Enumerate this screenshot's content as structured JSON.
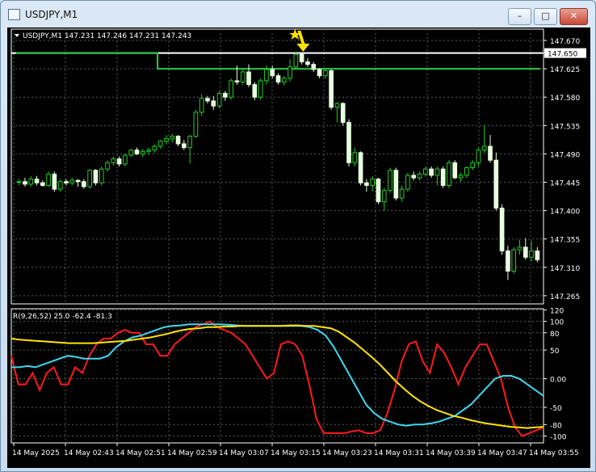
{
  "window": {
    "title": "USDJPY,M1",
    "buttons": {
      "minimize": "–",
      "maximize": "□",
      "close": "✕"
    }
  },
  "chart_data": [
    {
      "type": "candlestick",
      "info": "USDJPY,M1  147.231 147.246 147.231 147.243",
      "price_ticks": [
        "147.670",
        "147.625",
        "147.580",
        "147.535",
        "147.490",
        "147.445",
        "147.400",
        "147.355",
        "147.310",
        "147.265"
      ],
      "ylim": [
        147.252,
        147.688
      ],
      "current_price_label": "147.650",
      "candles": [
        [
          147.445,
          147.45,
          147.44,
          147.446
        ],
        [
          147.446,
          147.452,
          147.438,
          147.442
        ],
        [
          147.442,
          147.455,
          147.438,
          147.45
        ],
        [
          147.45,
          147.455,
          147.44,
          147.444
        ],
        [
          147.444,
          147.448,
          147.438,
          147.44
        ],
        [
          147.44,
          147.462,
          147.438,
          147.458
        ],
        [
          147.458,
          147.462,
          147.43,
          147.434
        ],
        [
          147.434,
          147.45,
          147.43,
          147.446
        ],
        [
          147.446,
          147.45,
          147.44,
          147.444
        ],
        [
          147.444,
          147.452,
          147.44,
          147.448
        ],
        [
          147.448,
          147.45,
          147.438,
          147.446
        ],
        [
          147.446,
          147.45,
          147.435,
          147.438
        ],
        [
          147.438,
          147.466,
          147.435,
          147.464
        ],
        [
          147.464,
          147.466,
          147.44,
          147.444
        ],
        [
          147.444,
          147.47,
          147.44,
          147.466
        ],
        [
          147.466,
          147.48,
          147.462,
          147.476
        ],
        [
          147.476,
          147.486,
          147.472,
          147.482
        ],
        [
          147.482,
          147.486,
          147.47,
          147.474
        ],
        [
          147.474,
          147.49,
          147.47,
          147.488
        ],
        [
          147.488,
          147.498,
          147.485,
          147.496
        ],
        [
          147.496,
          147.5,
          147.488,
          147.49
        ],
        [
          147.49,
          147.498,
          147.485,
          147.494
        ],
        [
          147.494,
          147.5,
          147.488,
          147.496
        ],
        [
          147.496,
          147.505,
          147.492,
          147.502
        ],
        [
          147.502,
          147.512,
          147.498,
          147.51
        ],
        [
          147.51,
          147.52,
          147.505,
          147.514
        ],
        [
          147.514,
          147.522,
          147.508,
          147.518
        ],
        [
          147.518,
          147.52,
          147.502,
          147.506
        ],
        [
          147.506,
          147.512,
          147.496,
          147.5
        ],
        [
          147.5,
          147.52,
          147.475,
          147.518
        ],
        [
          147.518,
          147.56,
          147.515,
          147.556
        ],
        [
          147.556,
          147.585,
          147.55,
          147.578
        ],
        [
          147.578,
          147.582,
          147.57,
          147.574
        ],
        [
          147.574,
          147.582,
          147.56,
          147.566
        ],
        [
          147.566,
          147.59,
          147.562,
          147.586
        ],
        [
          147.586,
          147.59,
          147.574,
          147.58
        ],
        [
          147.58,
          147.61,
          147.576,
          147.606
        ],
        [
          147.606,
          147.63,
          147.6,
          147.604
        ],
        [
          147.604,
          147.625,
          147.6,
          147.62
        ],
        [
          147.62,
          147.632,
          147.596,
          147.6
        ],
        [
          147.6,
          147.604,
          147.575,
          147.58
        ],
        [
          147.58,
          147.61,
          147.576,
          147.606
        ],
        [
          147.606,
          147.63,
          147.6,
          147.624
        ],
        [
          147.624,
          147.63,
          147.61,
          147.614
        ],
        [
          147.614,
          147.618,
          147.6,
          147.604
        ],
        [
          147.604,
          147.614,
          147.598,
          147.61
        ],
        [
          147.61,
          147.64,
          147.605,
          147.628
        ],
        [
          147.628,
          147.652,
          147.624,
          147.648
        ],
        [
          147.648,
          147.65,
          147.632,
          147.636
        ],
        [
          147.636,
          147.642,
          147.628,
          147.632
        ],
        [
          147.632,
          147.636,
          147.62,
          147.624
        ],
        [
          147.624,
          147.626,
          147.61,
          147.614
        ],
        [
          147.614,
          147.626,
          147.61,
          147.622
        ],
        [
          147.622,
          147.624,
          147.56,
          147.564
        ],
        [
          147.564,
          147.572,
          147.54,
          147.57
        ],
        [
          147.57,
          147.572,
          147.535,
          147.54
        ],
        [
          147.54,
          147.545,
          147.47,
          147.476
        ],
        [
          147.476,
          147.5,
          147.47,
          147.492
        ],
        [
          147.492,
          147.494,
          147.44,
          147.444
        ],
        [
          147.444,
          147.45,
          147.43,
          147.44
        ],
        [
          147.44,
          147.455,
          147.43,
          147.45
        ],
        [
          147.45,
          147.452,
          147.41,
          147.414
        ],
        [
          147.414,
          147.436,
          147.4,
          147.432
        ],
        [
          147.432,
          147.468,
          147.428,
          147.464
        ],
        [
          147.464,
          147.468,
          147.416,
          147.42
        ],
        [
          147.42,
          147.44,
          147.414,
          147.434
        ],
        [
          147.434,
          147.46,
          147.43,
          147.456
        ],
        [
          147.456,
          147.462,
          147.448,
          147.452
        ],
        [
          147.452,
          147.462,
          147.448,
          147.458
        ],
        [
          147.458,
          147.47,
          147.454,
          147.466
        ],
        [
          147.466,
          147.47,
          147.452,
          147.456
        ],
        [
          147.456,
          147.47,
          147.44,
          147.466
        ],
        [
          147.466,
          147.47,
          147.436,
          147.44
        ],
        [
          147.44,
          147.48,
          147.436,
          147.476
        ],
        [
          147.476,
          147.48,
          147.45,
          147.452
        ],
        [
          147.452,
          147.46,
          147.446,
          147.456
        ],
        [
          147.456,
          147.47,
          147.452,
          147.468
        ],
        [
          147.468,
          147.48,
          147.464,
          147.476
        ],
        [
          147.476,
          147.5,
          147.47,
          147.496
        ],
        [
          147.496,
          147.536,
          147.492,
          147.502
        ],
        [
          147.502,
          147.52,
          147.476,
          147.48
        ],
        [
          147.48,
          147.492,
          147.4,
          147.404
        ],
        [
          147.404,
          147.41,
          147.33,
          147.336
        ],
        [
          147.336,
          147.344,
          147.29,
          147.304
        ],
        [
          147.304,
          147.342,
          147.3,
          147.338
        ],
        [
          147.338,
          147.354,
          147.33,
          147.342
        ],
        [
          147.342,
          147.356,
          147.322,
          147.326
        ],
        [
          147.326,
          147.352,
          147.32,
          147.336
        ],
        [
          147.336,
          147.342,
          147.318,
          147.322
        ]
      ],
      "levels": [
        {
          "price": 147.65,
          "color": "#ffffff"
        },
        {
          "segments": [
            [
              0,
              24,
              147.65
            ],
            [
              24,
              89,
              147.625
            ]
          ],
          "color": "#22cc44"
        }
      ],
      "signal_arrow": {
        "index": 47,
        "direction": "down",
        "color": "#ffe200"
      },
      "grid": true
    },
    {
      "type": "line",
      "info": "R(9,26,52) 25.0 -62.4 -81.3",
      "ticks": [
        "120",
        "100",
        "80",
        "50",
        "0.00",
        "-50",
        "-80",
        "-100"
      ],
      "tick_values": [
        120,
        100,
        80,
        50,
        0,
        -50,
        -80,
        -100
      ],
      "ylim": [
        -112,
        122
      ],
      "series": [
        {
          "color": "#ff1a1a",
          "values": [
            40,
            -10,
            -10,
            10,
            -20,
            10,
            20,
            -10,
            -10,
            20,
            10,
            40,
            60,
            70,
            70,
            80,
            85,
            80,
            80,
            60,
            60,
            40,
            40,
            60,
            70,
            80,
            90,
            95,
            100,
            90,
            85,
            80,
            70,
            60,
            40,
            20,
            0,
            10,
            60,
            65,
            60,
            40,
            -10,
            -70,
            -95,
            -95,
            -95,
            -95,
            -92,
            -90,
            -95,
            -95,
            -90,
            -60,
            -20,
            30,
            60,
            65,
            30,
            10,
            60,
            45,
            20,
            -10,
            20,
            40,
            60,
            60,
            30,
            0,
            -50,
            -85,
            -100,
            -95,
            -90,
            -85
          ]
        },
        {
          "color": "#40d8f0",
          "values": [
            20,
            20,
            22,
            20,
            25,
            30,
            35,
            40,
            38,
            35,
            35,
            35,
            40,
            55,
            65,
            72,
            75,
            80,
            85,
            90,
            92,
            93,
            95,
            95,
            95,
            95,
            95,
            94,
            93,
            92,
            92,
            92,
            92,
            92,
            92,
            92,
            92,
            90,
            85,
            75,
            55,
            30,
            5,
            -20,
            -45,
            -60,
            -70,
            -75,
            -80,
            -82,
            -80,
            -80,
            -78,
            -75,
            -70,
            -65,
            -55,
            -45,
            -30,
            -15,
            0,
            5,
            5,
            0,
            -10,
            -20,
            -30
          ]
        },
        {
          "color": "#ffe400",
          "values": [
            70,
            68,
            67,
            66,
            65,
            64,
            63,
            62,
            62,
            62,
            62,
            63,
            64,
            65,
            66,
            68,
            70,
            72,
            75,
            78,
            82,
            85,
            87,
            88,
            90,
            90,
            91,
            91,
            92,
            92,
            92,
            92,
            92,
            92,
            93,
            93,
            92,
            92,
            90,
            88,
            82,
            72,
            62,
            50,
            38,
            25,
            10,
            -5,
            -18,
            -30,
            -40,
            -48,
            -55,
            -60,
            -65,
            -68,
            -72,
            -75,
            -78,
            -80,
            -82,
            -84,
            -85,
            -86,
            -85,
            -84
          ]
        }
      ],
      "grid": true
    }
  ],
  "time_axis": [
    "14 May 2025",
    "14 May 02:43",
    "14 May 02:51",
    "14 May 02:59",
    "14 May 03:07",
    "14 May 03:15",
    "14 May 03:23",
    "14 May 03:31",
    "14 May 03:39",
    "14 May 03:47",
    "14 May 03:55"
  ],
  "colors": {
    "bull": "#22cc22",
    "bear": "#e8ffe0",
    "grid": "#5a5a5a",
    "axis": "#ffffff"
  }
}
